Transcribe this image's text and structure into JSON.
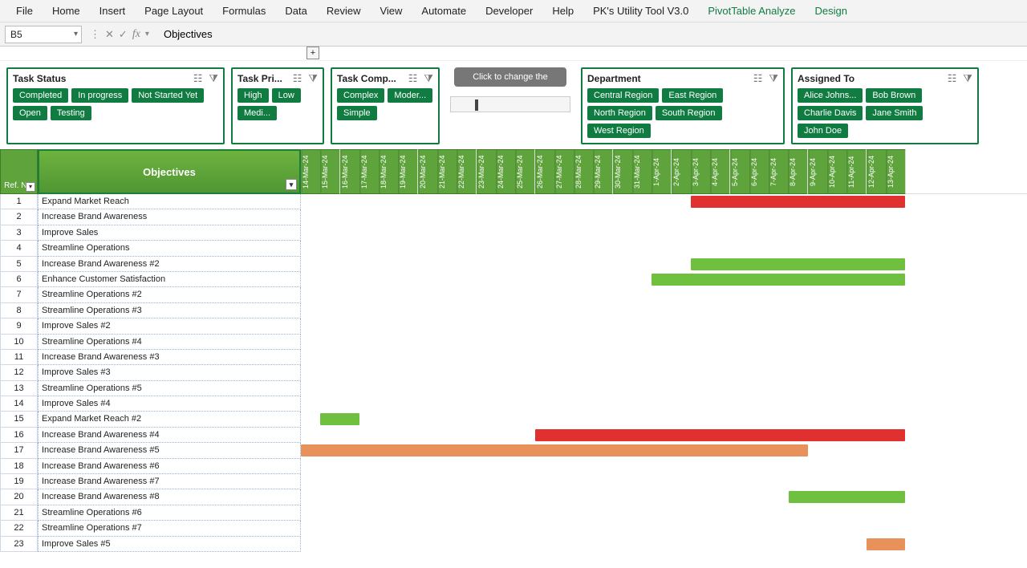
{
  "ribbon": {
    "tabs": [
      "File",
      "Home",
      "Insert",
      "Page Layout",
      "Formulas",
      "Data",
      "Review",
      "View",
      "Automate",
      "Developer",
      "Help",
      "PK's Utility Tool V3.0",
      "PivotTable Analyze",
      "Design"
    ]
  },
  "namebox": "B5",
  "formula": "Objectives",
  "plus": "+",
  "slicers": [
    {
      "title": "Task Status",
      "items": [
        "Completed",
        "In progress",
        "Not Started Yet",
        "Open",
        "Testing"
      ],
      "cls": "s1"
    },
    {
      "title": "Task Pri...",
      "items": [
        "High",
        "Low",
        "Medi..."
      ],
      "cls": "s2"
    },
    {
      "title": "Task Comp...",
      "items": [
        "Complex",
        "Moder...",
        "Simple"
      ],
      "cls": "s3"
    },
    {
      "title": "Department",
      "items": [
        "Central Region",
        "East Region",
        "North Region",
        "South Region",
        "West Region"
      ],
      "cls": "s4"
    },
    {
      "title": "Assigned To",
      "items": [
        "Alice Johns...",
        "Bob Brown",
        "Charlie Davis",
        "Jane Smith",
        "John Doe"
      ],
      "cls": "s5"
    }
  ],
  "tooltip": "Click to change the",
  "headers": {
    "ref": "Ref. No.",
    "obj": "Objectives"
  },
  "dates": [
    "14-Mar-24",
    "15-Mar-24",
    "16-Mar-24",
    "17-Mar-24",
    "18-Mar-24",
    "19-Mar-24",
    "20-Mar-24",
    "21-Mar-24",
    "22-Mar-24",
    "23-Mar-24",
    "24-Mar-24",
    "25-Mar-24",
    "26-Mar-24",
    "27-Mar-24",
    "28-Mar-24",
    "29-Mar-24",
    "30-Mar-24",
    "31-Mar-24",
    "1-Apr-24",
    "2-Apr-24",
    "3-Apr-24",
    "4-Apr-24",
    "5-Apr-24",
    "6-Apr-24",
    "7-Apr-24",
    "8-Apr-24",
    "9-Apr-24",
    "10-Apr-24",
    "11-Apr-24",
    "12-Apr-24",
    "13-Apr-24"
  ],
  "rows": [
    {
      "n": "1",
      "obj": "Expand Market Reach",
      "bars": [
        {
          "start": 20,
          "span": 11,
          "cls": "red"
        }
      ]
    },
    {
      "n": "2",
      "obj": "Increase Brand Awareness",
      "bars": []
    },
    {
      "n": "3",
      "obj": "Improve Sales",
      "bars": []
    },
    {
      "n": "4",
      "obj": "Streamline Operations",
      "bars": []
    },
    {
      "n": "5",
      "obj": "Increase Brand Awareness #2",
      "bars": [
        {
          "start": 20,
          "span": 11,
          "cls": "green"
        }
      ]
    },
    {
      "n": "6",
      "obj": "Enhance Customer Satisfaction",
      "bars": [
        {
          "start": 18,
          "span": 13,
          "cls": "green"
        }
      ]
    },
    {
      "n": "7",
      "obj": "Streamline Operations #2",
      "bars": []
    },
    {
      "n": "8",
      "obj": "Streamline Operations #3",
      "bars": []
    },
    {
      "n": "9",
      "obj": "Improve Sales #2",
      "bars": []
    },
    {
      "n": "10",
      "obj": "Streamline Operations #4",
      "bars": []
    },
    {
      "n": "11",
      "obj": "Increase Brand Awareness #3",
      "bars": []
    },
    {
      "n": "12",
      "obj": "Improve Sales #3",
      "bars": []
    },
    {
      "n": "13",
      "obj": "Streamline Operations #5",
      "bars": []
    },
    {
      "n": "14",
      "obj": "Improve Sales #4",
      "bars": []
    },
    {
      "n": "15",
      "obj": "Expand Market Reach #2",
      "bars": [
        {
          "start": 1,
          "span": 2,
          "cls": "green"
        }
      ]
    },
    {
      "n": "16",
      "obj": "Increase Brand Awareness #4",
      "bars": [
        {
          "start": 12,
          "span": 19,
          "cls": "red"
        }
      ]
    },
    {
      "n": "17",
      "obj": "Increase Brand Awareness #5",
      "bars": [
        {
          "start": 0,
          "span": 26,
          "cls": "orange"
        }
      ]
    },
    {
      "n": "18",
      "obj": "Increase Brand Awareness #6",
      "bars": []
    },
    {
      "n": "19",
      "obj": "Increase Brand Awareness #7",
      "bars": []
    },
    {
      "n": "20",
      "obj": "Increase Brand Awareness #8",
      "bars": [
        {
          "start": 25,
          "span": 6,
          "cls": "green"
        }
      ]
    },
    {
      "n": "21",
      "obj": "Streamline Operations #6",
      "bars": []
    },
    {
      "n": "22",
      "obj": "Streamline Operations #7",
      "bars": []
    },
    {
      "n": "23",
      "obj": "Improve Sales #5",
      "bars": [
        {
          "start": 29,
          "span": 2,
          "cls": "orange"
        }
      ]
    }
  ],
  "colw": 24.3
}
